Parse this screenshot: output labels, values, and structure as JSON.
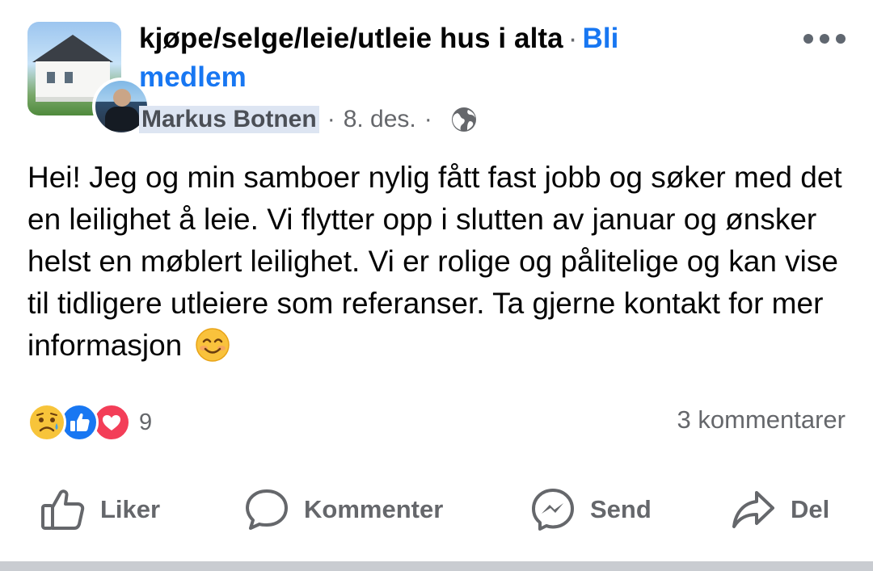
{
  "group": {
    "name": "kjøpe/selge/leie/utleie hus i alta",
    "separator": "·",
    "join_label": "Bli medlem"
  },
  "post": {
    "author": "Markus Botnen",
    "date": "8. des.",
    "audience_icon": "globe-icon",
    "body": "Hei! Jeg og min samboer nylig fått fast jobb og søker med det en leilighet å leie. Vi flytter opp i slutten av januar og ønsker helst en møblert leilighet. Vi er rolige og pålitelige og kan vise til tidligere utleiere som referanser. Ta gjerne kontakt for mer informasjon",
    "emoji": "smiling-face-icon"
  },
  "stats": {
    "reactions": [
      "sad",
      "like",
      "love"
    ],
    "reaction_count": "9",
    "comments": "3 kommentarer"
  },
  "actions": {
    "like": "Liker",
    "comment": "Kommenter",
    "send": "Send",
    "share": "Del"
  },
  "colors": {
    "link": "#1877f2",
    "secondary_text": "#65676b",
    "author_highlight": "#dde5f2"
  }
}
